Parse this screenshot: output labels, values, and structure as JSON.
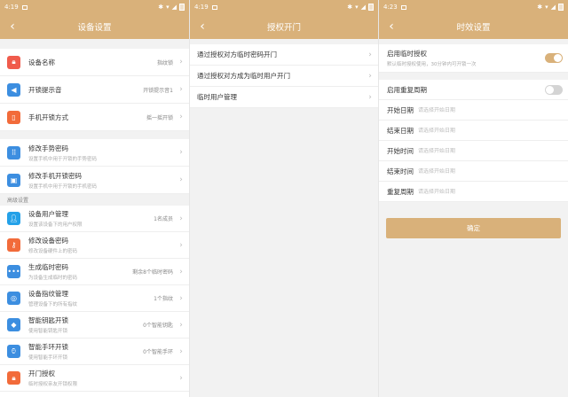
{
  "theme": {
    "accent": "#d9b17a"
  },
  "screens": [
    {
      "status": {
        "time": "4:19"
      },
      "nav": {
        "title": "设备设置"
      },
      "group1": [
        {
          "icon": "lock-icon",
          "color": "#f05b4c",
          "title": "设备名称",
          "value": "指纹锁"
        },
        {
          "icon": "speaker-icon",
          "color": "#3c8ee0",
          "title": "开锁提示音",
          "value": "开锁提示音1"
        },
        {
          "icon": "phone-icon",
          "color": "#f26b3a",
          "title": "手机开锁方式",
          "value": "摇一摇开锁"
        }
      ],
      "group2": [
        {
          "icon": "keypad-icon",
          "color": "#3c8ee0",
          "title": "修改手势密码",
          "subtitle": "设置手机中用于开锁的手势密码"
        },
        {
          "icon": "lock-phone-icon",
          "color": "#3c8ee0",
          "title": "修改手机开锁密码",
          "subtitle": "设置手机中用于开锁的手机密码"
        }
      ],
      "section_label": "高级设置",
      "group3": [
        {
          "icon": "user-icon",
          "color": "#24a1e8",
          "title": "设备用户管理",
          "subtitle": "设置该设备下的用户权限",
          "value": "1名成员"
        },
        {
          "icon": "key-icon",
          "color": "#f26b3a",
          "title": "修改设备密码",
          "subtitle": "修改设备硬件上的密码"
        },
        {
          "icon": "dots-icon",
          "color": "#3c8ee0",
          "title": "生成临时密码",
          "subtitle": "为设备生成临时的密码",
          "value": "剩余8个临时密码"
        },
        {
          "icon": "fingerprint-icon",
          "color": "#3c8ee0",
          "title": "设备指纹管理",
          "subtitle": "管理设备下的所有指纹",
          "value": "1个指纹"
        },
        {
          "icon": "key-card-icon",
          "color": "#3c8ee0",
          "title": "智能钥匙开锁",
          "subtitle": "使用智能钥匙开锁",
          "value": "0个智能钥匙"
        },
        {
          "icon": "watch-icon",
          "color": "#3c8ee0",
          "title": "智能手环开锁",
          "subtitle": "使用智能手环开锁",
          "value": "0个智能手环"
        },
        {
          "icon": "auth-icon",
          "color": "#f26b3a",
          "title": "开门授权",
          "subtitle": "临时授权亲友开锁权限"
        }
      ]
    },
    {
      "status": {
        "time": "4:19"
      },
      "nav": {
        "title": "授权开门"
      },
      "items": [
        {
          "title": "通过授权对方临时密码开门"
        },
        {
          "title": "通过授权对方成为临时用户开门"
        },
        {
          "title": "临时用户管理"
        }
      ]
    },
    {
      "status": {
        "time": "4:23"
      },
      "nav": {
        "title": "时效设置"
      },
      "temp_auth": {
        "title": "启用临时授权",
        "subtitle": "默认临时授权使用，30分钟内可开锁一次",
        "on": true
      },
      "repeat": {
        "title": "启用重复周期",
        "on": false
      },
      "fields": [
        {
          "label": "开始日期",
          "placeholder": "请选择开始日期"
        },
        {
          "label": "结束日期",
          "placeholder": "请选择开始日期"
        },
        {
          "label": "开始时间",
          "placeholder": "请选择开始日期"
        },
        {
          "label": "结束时间",
          "placeholder": "请选择开始日期"
        },
        {
          "label": "重复周期",
          "placeholder": "请选择开始日期"
        }
      ],
      "confirm_label": "确定"
    }
  ]
}
